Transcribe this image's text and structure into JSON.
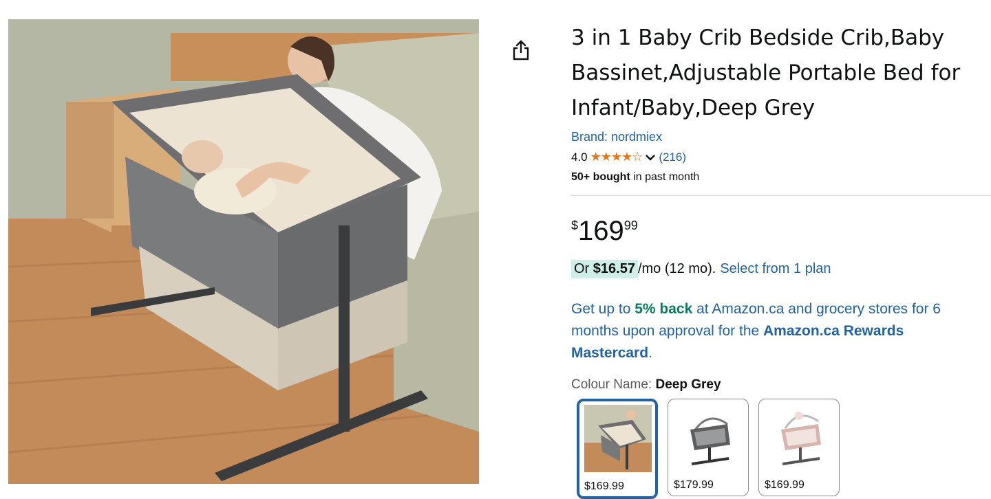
{
  "product": {
    "title": "3 in 1 Baby Crib Bedside Crib,Baby Bassinet,Adjustable Portable Bed for Infant/Baby,Deep Grey",
    "brand": "Brand: nordmiex",
    "rating": "4.0",
    "review_count": "(216)",
    "bought_bold": "50+ bought",
    "bought_rest": " in past month"
  },
  "price": {
    "symbol": "$",
    "whole": "169",
    "fraction": "99"
  },
  "installment": {
    "prefix": "Or ",
    "amount": "$16.57",
    "suffix": " /mo (12 mo). ",
    "plan_link": "Select from 1 plan"
  },
  "rewards": {
    "p1": "Get up to ",
    "p2": "5% back",
    "p3": " at Amazon.ca and grocery stores for 6",
    "p4": "months upon approval for the ",
    "p5": "Amazon.ca Rewards",
    "p6": "Mastercard",
    "p7": "."
  },
  "colour": {
    "label": "Colour Name: ",
    "selected": "Deep Grey",
    "options": [
      {
        "name": "deep-grey",
        "price": "$169.99"
      },
      {
        "name": "grey",
        "price": "$179.99"
      },
      {
        "name": "pink",
        "price": "$169.99"
      }
    ]
  },
  "icons": {
    "share": "share-icon",
    "star": "star-icon",
    "chevron": "chevron-down-icon"
  },
  "colors": {
    "link": "#2162a1",
    "star": "#de7921",
    "installment_bg": "#cfeee8",
    "selected_border": "#2162a1",
    "green": "#067d62"
  }
}
